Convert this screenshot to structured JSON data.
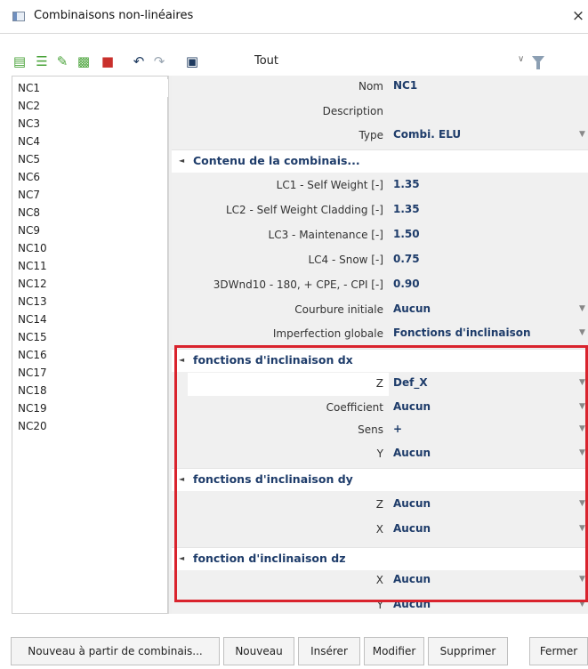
{
  "window": {
    "title": "Combinaisons non-linéaires",
    "close_glyph": "×"
  },
  "toolbar": {
    "filter_label": "Tout",
    "icons": [
      "new-icon",
      "insert-icon",
      "edit-icon",
      "copy-icon",
      "delete-icon",
      "undo-icon",
      "redo-icon",
      "table-icon",
      "filter-icon"
    ]
  },
  "list": {
    "items": [
      "NC1",
      "NC2",
      "NC3",
      "NC4",
      "NC5",
      "NC6",
      "NC7",
      "NC8",
      "NC9",
      "NC10",
      "NC11",
      "NC12",
      "NC13",
      "NC14",
      "NC15",
      "NC16",
      "NC17",
      "NC18",
      "NC19",
      "NC20"
    ],
    "selected": "NC1"
  },
  "properties": {
    "nom": {
      "label": "Nom",
      "value": "NC1"
    },
    "description": {
      "label": "Description",
      "value": ""
    },
    "type": {
      "label": "Type",
      "value": "Combi. ELU"
    },
    "contenu_header": "Contenu de la combinais...",
    "lc1": {
      "label": "LC1 - Self Weight [-]",
      "value": "1.35"
    },
    "lc2": {
      "label": "LC2 - Self Weight Cladding [-]",
      "value": "1.35"
    },
    "lc3": {
      "label": "LC3 - Maintenance [-]",
      "value": "1.50"
    },
    "lc4": {
      "label": "LC4 - Snow [-]",
      "value": "0.75"
    },
    "wind": {
      "label": "3DWnd10 - 180, + CPE, - CPI [-]",
      "value": "0.90"
    },
    "courbure": {
      "label": "Courbure initiale",
      "value": "Aucun"
    },
    "imperfection": {
      "label": "Imperfection globale",
      "value": "Fonctions d'inclinaison"
    },
    "dx_header": "fonctions d'inclinaison dx",
    "dx_z": {
      "label": "Z",
      "value": "Def_X"
    },
    "dx_coef": {
      "label": "Coefficient",
      "value": "Aucun"
    },
    "dx_sens": {
      "label": "Sens",
      "value": "+"
    },
    "dx_y": {
      "label": "Y",
      "value": "Aucun"
    },
    "dy_header": "fonctions d'inclinaison dy",
    "dy_z": {
      "label": "Z",
      "value": "Aucun"
    },
    "dy_x": {
      "label": "X",
      "value": "Aucun"
    },
    "dz_header": "fonction d'inclinaison dz",
    "dz_x": {
      "label": "X",
      "value": "Aucun"
    },
    "dz_y": {
      "label": "Y",
      "value": "Aucun"
    }
  },
  "buttons": {
    "new_from": "Nouveau à partir de combinais...",
    "new": "Nouveau",
    "insert": "Insérer",
    "modify": "Modifier",
    "delete": "Supprimer",
    "close": "Fermer"
  },
  "colors": {
    "value_text": "#1e3c6a",
    "highlight_box": "#d9232d"
  }
}
